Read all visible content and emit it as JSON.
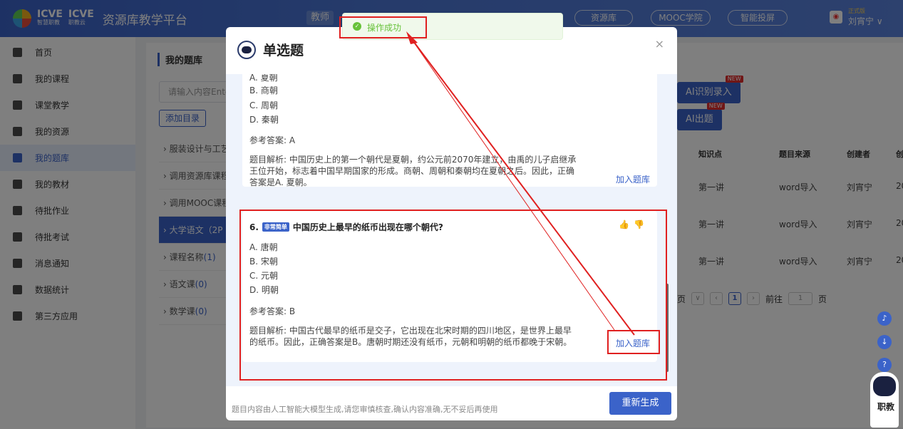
{
  "topbar": {
    "logo_icve1": "ICVE",
    "logo_icve1_sub": "智慧职教",
    "logo_icve2": "ICVE",
    "logo_icve2_sub": "职教云",
    "platform_title": "资源库教学平台",
    "teacher_tab": "教师",
    "nav": [
      "资源库",
      "MOOC学院",
      "智能投屏"
    ],
    "user_badge": "正式版",
    "user_name": "刘宵宁 ∨"
  },
  "sidebar": {
    "items": [
      {
        "label": "首页"
      },
      {
        "label": "我的课程"
      },
      {
        "label": "课堂教学"
      },
      {
        "label": "我的资源"
      },
      {
        "label": "我的题库"
      },
      {
        "label": "我的教材"
      },
      {
        "label": "待批作业"
      },
      {
        "label": "待批考试"
      },
      {
        "label": "消息通知"
      },
      {
        "label": "数据统计"
      },
      {
        "label": "第三方应用"
      }
    ]
  },
  "main": {
    "title": "我的题库",
    "search_placeholder": "请输入内容Ente",
    "add_dir": "添加目录",
    "tree": [
      {
        "label": "服装设计与工艺",
        "count": ""
      },
      {
        "label": "调用资源库课程",
        "count": ""
      },
      {
        "label": "调用MOOC课程",
        "count": ""
      },
      {
        "label": "大学语文（2P",
        "count": ""
      },
      {
        "label": "课程名称",
        "count": "(1)"
      },
      {
        "label": "语文课",
        "count": "(0)"
      },
      {
        "label": "数学课",
        "count": "(0)"
      }
    ],
    "ai_recognize": "AI识别录入",
    "ai_generate": "AI出题",
    "new_tag": "NEW",
    "columns": [
      "知识点",
      "题目来源",
      "创建者",
      "创"
    ],
    "rows": [
      [
        "第一讲",
        "word导入",
        "刘宵宁",
        "20"
      ],
      [
        "第一讲",
        "word导入",
        "刘宵宁",
        "20"
      ],
      [
        "第一讲",
        "word导入",
        "刘宵宁",
        "20"
      ]
    ],
    "pager_prefix": "页",
    "pager_current": "1",
    "pager_goto": "前往",
    "pager_input": "1",
    "pager_suffix": "页"
  },
  "dialog": {
    "title": "单选题",
    "card1": {
      "options": [
        "A. 夏朝",
        "B. 商朝",
        "C. 周朝",
        "D. 秦朝"
      ],
      "answer": "参考答案: A",
      "explain": "题目解析: 中国历史上的第一个朝代是夏朝，约公元前2070年建立，由禹的儿子启继承王位开始，标志着中国早期国家的形成。商朝、周朝和秦朝均在夏朝之后。因此，正确答案是A. 夏朝。",
      "add": "加入题库"
    },
    "card2": {
      "number": "6.",
      "difficulty": "非常简单",
      "question": "中国历史上最早的纸币出现在哪个朝代?",
      "options": [
        "A. 唐朝",
        "B. 宋朝",
        "C. 元朝",
        "D. 明朝"
      ],
      "answer": "参考答案: B",
      "explain": "题目解析: 中国古代最早的纸币是交子，它出现在北宋时期的四川地区，是世界上最早的纸币。因此，正确答案是B。唐朝时期还没有纸币，元朝和明朝的纸币都晚于宋朝。",
      "add": "加入题库"
    },
    "footer_note": "题目内容由人工智能大模型生成,请您审慎核查,确认内容准确,无不妥后再使用",
    "regenerate": "重新生成"
  },
  "toast": {
    "message": "操作成功"
  },
  "robot": {
    "label": "职教"
  },
  "colors": {
    "primary": "#3b63c9",
    "success": "#67c23a",
    "annotation": "#e02020"
  }
}
